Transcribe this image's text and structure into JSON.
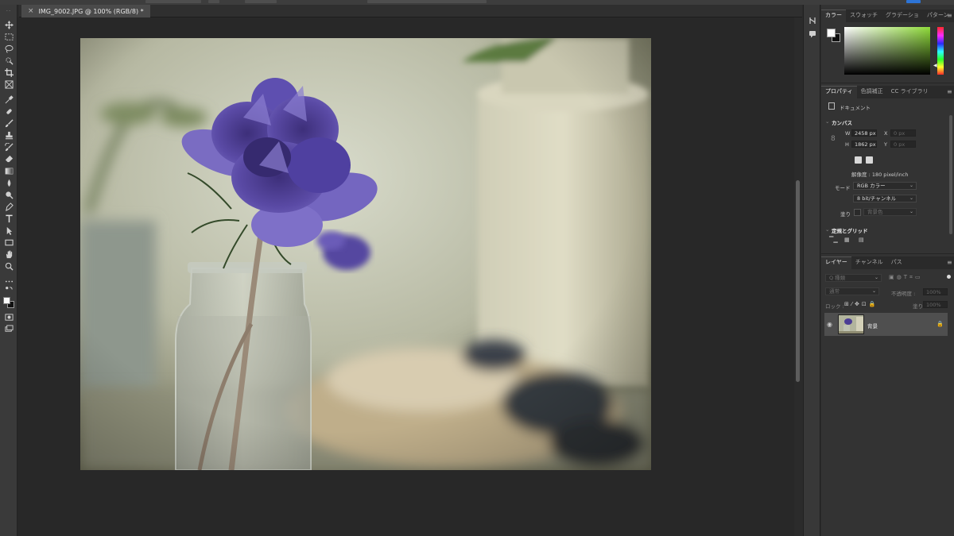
{
  "document_tab": {
    "close_glyph": "×",
    "title": "IMG_9002.JPG @ 100% (RGB/8) *"
  },
  "tools": [
    "move-tool",
    "marquee-tool",
    "lasso-tool",
    "quick-selection-tool",
    "crop-tool",
    "frame-tool",
    "eyedropper-tool",
    "healing-brush-tool",
    "brush-tool",
    "clone-stamp-tool",
    "history-brush-tool",
    "eraser-tool",
    "gradient-tool",
    "blur-tool",
    "dodge-tool",
    "pen-tool",
    "type-tool",
    "path-selection-tool",
    "rectangle-tool",
    "hand-tool",
    "zoom-tool",
    "more-tools"
  ],
  "color_panel": {
    "tabs": [
      "カラー",
      "スウォッチ",
      "グラデーショ",
      "パターン"
    ],
    "active_tab": "カラー",
    "hue_color": "#8fdb3a"
  },
  "properties_panel": {
    "tabs": [
      "プロパティ",
      "色調補正",
      "CC ライブラリ"
    ],
    "active_tab": "プロパティ",
    "doc_label": "ドキュメント",
    "canvas_section": "カンバス",
    "w_label": "W",
    "w_value": "2458 px",
    "h_label": "H",
    "h_value": "1862 px",
    "x_label": "X",
    "x_value": "0 px",
    "y_label": "Y",
    "y_value": "0 px",
    "resolution": "解像度 : 180 pixel/inch",
    "mode_label": "モード",
    "mode_value": "RGB カラー",
    "depth_value": "8 bit/チャンネル",
    "fill_label": "塗り",
    "fill_value": "背景色",
    "rulers_section": "定規とグリッド"
  },
  "layers_panel": {
    "tabs": [
      "レイヤー",
      "チャンネル",
      "パス"
    ],
    "active_tab": "レイヤー",
    "search_placeholder": "Q 種類",
    "blend_mode": "通常",
    "opacity_label": "不透明度 :",
    "opacity_value": "100%",
    "lock_label": "ロック :",
    "fill_label": "塗り :",
    "fill_value": "100%",
    "layers": [
      {
        "name": "背景",
        "visible": true,
        "locked": true
      }
    ]
  }
}
